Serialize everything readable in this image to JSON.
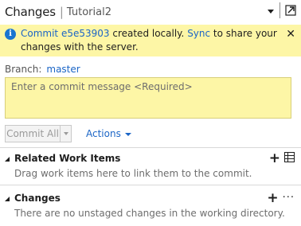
{
  "window": {
    "title": "Changes",
    "subtitle": "Tutorial2"
  },
  "info_bar": {
    "commit_link": "Commit e5e53903",
    "text_1": " created locally. ",
    "sync_link": "Sync",
    "text_2": " to share your changes with the server.",
    "close": "✕"
  },
  "branch": {
    "label": "Branch:",
    "value": "master"
  },
  "commit_message": {
    "placeholder": "Enter a commit message <Required>"
  },
  "toolbar": {
    "commit_all_label": "Commit All",
    "actions_label": "Actions"
  },
  "sections": [
    {
      "title": "Related Work Items",
      "description": "Drag work items here to link them to the commit."
    },
    {
      "title": "Changes",
      "description": "There are no unstaged changes in the working directory."
    }
  ],
  "colors": {
    "info_background": "#fdf6a6",
    "link": "#1b65c6",
    "info_icon": "#1b75d0"
  },
  "icons": [
    "info-icon",
    "close-icon",
    "dropdown-icon",
    "popout-icon",
    "add-icon",
    "grid-icon",
    "more-icon",
    "collapse-triangle-icon"
  ]
}
